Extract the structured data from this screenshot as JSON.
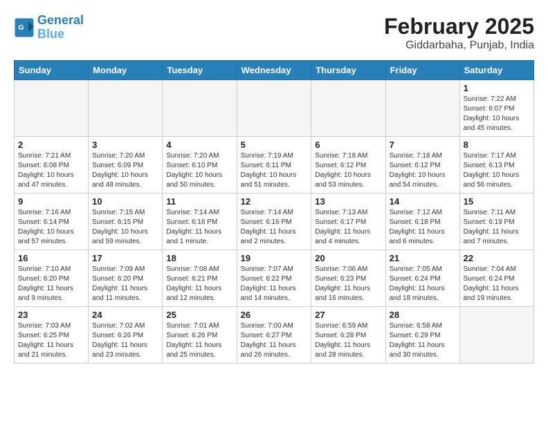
{
  "header": {
    "logo_line1": "General",
    "logo_line2": "Blue",
    "month_year": "February 2025",
    "location": "Giddarbaha, Punjab, India"
  },
  "weekdays": [
    "Sunday",
    "Monday",
    "Tuesday",
    "Wednesday",
    "Thursday",
    "Friday",
    "Saturday"
  ],
  "weeks": [
    [
      {
        "day": "",
        "info": ""
      },
      {
        "day": "",
        "info": ""
      },
      {
        "day": "",
        "info": ""
      },
      {
        "day": "",
        "info": ""
      },
      {
        "day": "",
        "info": ""
      },
      {
        "day": "",
        "info": ""
      },
      {
        "day": "1",
        "info": "Sunrise: 7:22 AM\nSunset: 6:07 PM\nDaylight: 10 hours\nand 45 minutes."
      }
    ],
    [
      {
        "day": "2",
        "info": "Sunrise: 7:21 AM\nSunset: 6:08 PM\nDaylight: 10 hours\nand 47 minutes."
      },
      {
        "day": "3",
        "info": "Sunrise: 7:20 AM\nSunset: 6:09 PM\nDaylight: 10 hours\nand 48 minutes."
      },
      {
        "day": "4",
        "info": "Sunrise: 7:20 AM\nSunset: 6:10 PM\nDaylight: 10 hours\nand 50 minutes."
      },
      {
        "day": "5",
        "info": "Sunrise: 7:19 AM\nSunset: 6:11 PM\nDaylight: 10 hours\nand 51 minutes."
      },
      {
        "day": "6",
        "info": "Sunrise: 7:18 AM\nSunset: 6:12 PM\nDaylight: 10 hours\nand 53 minutes."
      },
      {
        "day": "7",
        "info": "Sunrise: 7:18 AM\nSunset: 6:12 PM\nDaylight: 10 hours\nand 54 minutes."
      },
      {
        "day": "8",
        "info": "Sunrise: 7:17 AM\nSunset: 6:13 PM\nDaylight: 10 hours\nand 56 minutes."
      }
    ],
    [
      {
        "day": "9",
        "info": "Sunrise: 7:16 AM\nSunset: 6:14 PM\nDaylight: 10 hours\nand 57 minutes."
      },
      {
        "day": "10",
        "info": "Sunrise: 7:15 AM\nSunset: 6:15 PM\nDaylight: 10 hours\nand 59 minutes."
      },
      {
        "day": "11",
        "info": "Sunrise: 7:14 AM\nSunset: 6:16 PM\nDaylight: 11 hours\nand 1 minute."
      },
      {
        "day": "12",
        "info": "Sunrise: 7:14 AM\nSunset: 6:16 PM\nDaylight: 11 hours\nand 2 minutes."
      },
      {
        "day": "13",
        "info": "Sunrise: 7:13 AM\nSunset: 6:17 PM\nDaylight: 11 hours\nand 4 minutes."
      },
      {
        "day": "14",
        "info": "Sunrise: 7:12 AM\nSunset: 6:18 PM\nDaylight: 11 hours\nand 6 minutes."
      },
      {
        "day": "15",
        "info": "Sunrise: 7:11 AM\nSunset: 6:19 PM\nDaylight: 11 hours\nand 7 minutes."
      }
    ],
    [
      {
        "day": "16",
        "info": "Sunrise: 7:10 AM\nSunset: 6:20 PM\nDaylight: 11 hours\nand 9 minutes."
      },
      {
        "day": "17",
        "info": "Sunrise: 7:09 AM\nSunset: 6:20 PM\nDaylight: 11 hours\nand 11 minutes."
      },
      {
        "day": "18",
        "info": "Sunrise: 7:08 AM\nSunset: 6:21 PM\nDaylight: 11 hours\nand 12 minutes."
      },
      {
        "day": "19",
        "info": "Sunrise: 7:07 AM\nSunset: 6:22 PM\nDaylight: 11 hours\nand 14 minutes."
      },
      {
        "day": "20",
        "info": "Sunrise: 7:06 AM\nSunset: 6:23 PM\nDaylight: 11 hours\nand 16 minutes."
      },
      {
        "day": "21",
        "info": "Sunrise: 7:05 AM\nSunset: 6:24 PM\nDaylight: 11 hours\nand 18 minutes."
      },
      {
        "day": "22",
        "info": "Sunrise: 7:04 AM\nSunset: 6:24 PM\nDaylight: 11 hours\nand 19 minutes."
      }
    ],
    [
      {
        "day": "23",
        "info": "Sunrise: 7:03 AM\nSunset: 6:25 PM\nDaylight: 11 hours\nand 21 minutes."
      },
      {
        "day": "24",
        "info": "Sunrise: 7:02 AM\nSunset: 6:26 PM\nDaylight: 11 hours\nand 23 minutes."
      },
      {
        "day": "25",
        "info": "Sunrise: 7:01 AM\nSunset: 6:26 PM\nDaylight: 11 hours\nand 25 minutes."
      },
      {
        "day": "26",
        "info": "Sunrise: 7:00 AM\nSunset: 6:27 PM\nDaylight: 11 hours\nand 26 minutes."
      },
      {
        "day": "27",
        "info": "Sunrise: 6:59 AM\nSunset: 6:28 PM\nDaylight: 11 hours\nand 28 minutes."
      },
      {
        "day": "28",
        "info": "Sunrise: 6:58 AM\nSunset: 6:29 PM\nDaylight: 11 hours\nand 30 minutes."
      },
      {
        "day": "",
        "info": ""
      }
    ]
  ]
}
